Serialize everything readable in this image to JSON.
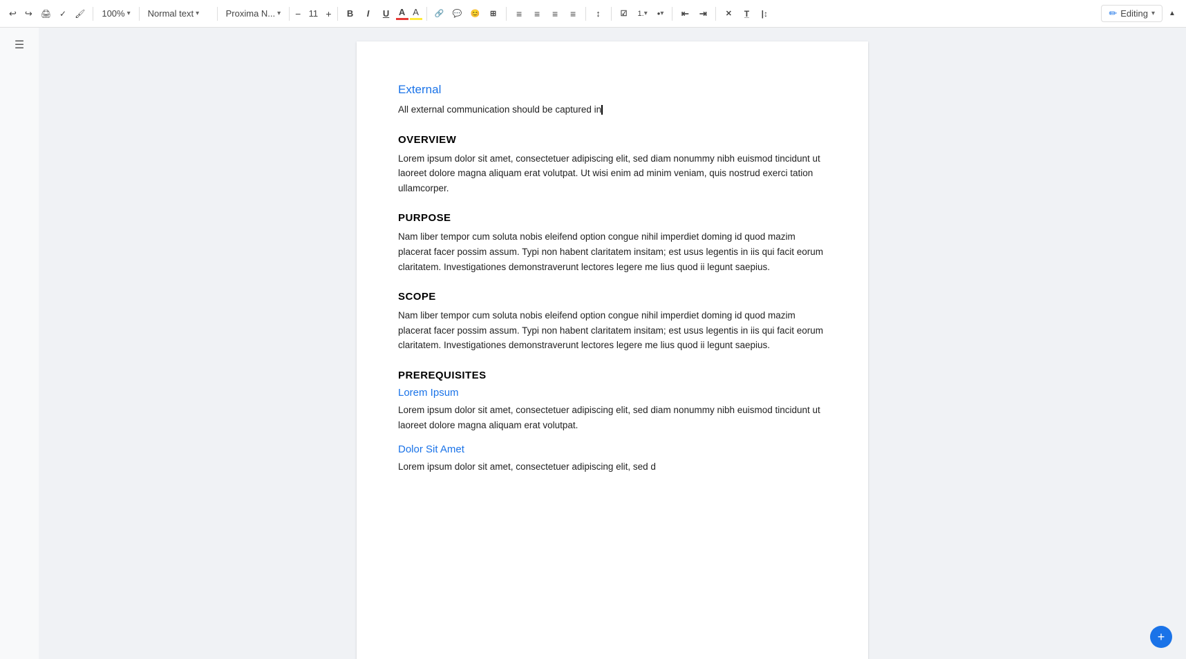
{
  "toolbar": {
    "undo_label": "↩",
    "redo_label": "↪",
    "print_label": "🖨",
    "spelling_label": "✓",
    "paint_label": "🖌",
    "zoom_value": "100%",
    "style_label": "Normal text",
    "font_label": "Proxima N...",
    "font_size": "11",
    "bold_label": "B",
    "italic_label": "I",
    "underline_label": "U",
    "text_color_label": "A",
    "highlight_label": "A",
    "link_label": "🔗",
    "comment_label": "💬",
    "emoji_label": "😊",
    "image_label": "⊞",
    "align_left": "align-left",
    "align_center": "align-center",
    "align_right": "align-right",
    "align_justify": "align-justify",
    "line_height": "↕",
    "numbered_list": "ordered-list",
    "bulleted_list": "unordered-list",
    "indent_less": "indent-decrease",
    "indent_more": "indent-increase",
    "clear_format": "✕",
    "editing_label": "Editing",
    "collapse_label": "▲"
  },
  "doc": {
    "section1": {
      "heading": "External",
      "body": "All external communication should be captured in"
    },
    "section2": {
      "heading": "OVERVIEW",
      "body": "Lorem ipsum dolor sit amet, consectetuer adipiscing elit, sed diam nonummy nibh euismod tincidunt ut laoreet dolore magna aliquam erat volutpat. Ut wisi enim ad minim veniam, quis nostrud exerci tation ullamcorper."
    },
    "section3": {
      "heading": "PURPOSE",
      "body": "Nam liber tempor cum soluta nobis eleifend option congue nihil imperdiet doming id quod mazim placerat facer possim assum. Typi non habent claritatem insitam; est usus legentis in iis qui facit eorum claritatem. Investigationes demonstraverunt lectores legere me lius quod ii legunt saepius."
    },
    "section4": {
      "heading": "SCOPE",
      "body": "Nam liber tempor cum soluta nobis eleifend option congue nihil imperdiet doming id quod mazim placerat facer possim assum. Typi non habent claritatem insitam; est usus legentis in iis qui facit eorum claritatem. Investigationes demonstraverunt lectores legere me lius quod ii legunt saepius."
    },
    "section5": {
      "heading": "PREREQUISITES",
      "subsection1": {
        "heading": "Lorem Ipsum",
        "body": "Lorem ipsum dolor sit amet, consectetuer adipiscing elit, sed diam nonummy nibh euismod tincidunt ut laoreet dolore magna aliquam erat volutpat."
      },
      "subsection2": {
        "heading": "Dolor Sit Amet",
        "body": "Lorem ipsum dolor sit amet, consectetuer adipiscing elit, sed d"
      }
    }
  }
}
